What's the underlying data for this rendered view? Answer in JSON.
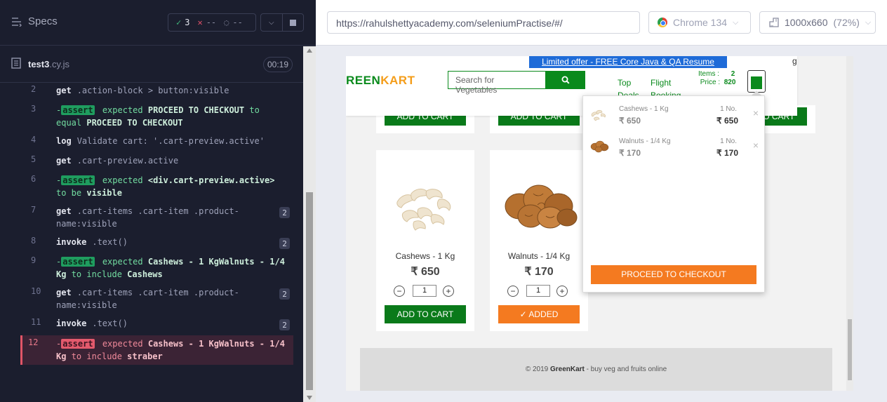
{
  "reporter": {
    "specs_label": "Specs",
    "stats": {
      "passed": "3",
      "failed": "--",
      "pending": "--"
    },
    "spec_file": {
      "name": "test3",
      "ext": ".cy.js",
      "duration": "00:19"
    },
    "commands": [
      {
        "num": "2",
        "name": "get",
        "lines": [
          ".action-block > button:visible"
        ]
      },
      {
        "num": "3",
        "assert": true,
        "pre": "expected",
        "v1": "PROCEED TO CHECKOUT",
        "mid": "to",
        "line2_pre": "equal",
        "v2": "PROCEED TO CHECKOUT"
      },
      {
        "num": "4",
        "name": "log",
        "lines": [
          "Validate cart: '.cart-preview.active'"
        ]
      },
      {
        "num": "5",
        "name": "get",
        "lines": [
          ".cart-preview.active"
        ]
      },
      {
        "num": "6",
        "assert": true,
        "pre": "expected",
        "v1": "<div.cart-preview.active>",
        "line2_pre": "to be",
        "v2": "visible"
      },
      {
        "num": "7",
        "name": "get",
        "lines": [
          ".cart-items .cart-item .product-",
          "name:visible"
        ],
        "count": "2"
      },
      {
        "num": "8",
        "name": "invoke",
        "lines": [
          ".text()"
        ],
        "count": "2"
      },
      {
        "num": "9",
        "assert": true,
        "pre": "expected",
        "v1": "Cashews - 1 KgWalnuts - 1/4",
        "line2_v": "Kg",
        "line2_pre": "to include",
        "v2": "Cashews"
      },
      {
        "num": "10",
        "name": "get",
        "lines": [
          ".cart-items .cart-item .product-",
          "name:visible"
        ],
        "count": "2"
      },
      {
        "num": "11",
        "name": "invoke",
        "lines": [
          ".text()"
        ],
        "count": "2"
      },
      {
        "num": "12",
        "assert": true,
        "failed": true,
        "pre": "expected",
        "v1": "Cashews - 1 KgWalnuts - 1/4",
        "line2_v": "Kg",
        "line2_pre": "to include",
        "v2": "straber"
      }
    ],
    "assert_label": "assert"
  },
  "browser": {
    "url": "https://rahulshettyacademy.com/seleniumPractise/#/",
    "name": "Chrome 134",
    "viewport": "1000x660",
    "zoom": "(72%)"
  },
  "site": {
    "offer": "Limited offer - FREE Core Java & QA Resume course",
    "offer_tail": "g",
    "logo_a": "REEN",
    "logo_b": "KART",
    "search_placeholder": "Search for Vegetables",
    "nav": [
      {
        "l1": "Top",
        "l2": "Deals"
      },
      {
        "l1": "Flight",
        "l2": "Booking"
      }
    ],
    "items_label": "Items",
    "items_value": "2",
    "price_label": "Price",
    "price_value": "820",
    "add_to_cart": "ADD TO CART",
    "added": "✓ ADDED",
    "products": [
      {
        "name": "Cashews - 1 Kg",
        "price": "₹ 650",
        "qty": "1"
      },
      {
        "name": "Walnuts - 1/4 Kg",
        "price": "₹ 170",
        "qty": "1"
      }
    ],
    "cart": [
      {
        "name": "Cashews - 1 Kg",
        "price": "₹ 650",
        "qty": "1 No.",
        "total": "₹ 650"
      },
      {
        "name": "Walnuts - 1/4 Kg",
        "price": "₹ 170",
        "qty": "1 No.",
        "total": "₹ 170"
      }
    ],
    "proceed": "PROCEED TO CHECKOUT",
    "footer_pre": "© 2019 ",
    "footer_brand": "GreenKart",
    "footer_post": " - buy veg and fruits online"
  },
  "colors": {
    "accent_green": "#0a8a1c",
    "accent_orange": "#f47a20",
    "fail_red": "#e05567",
    "pass_green": "#1f9d5f"
  }
}
